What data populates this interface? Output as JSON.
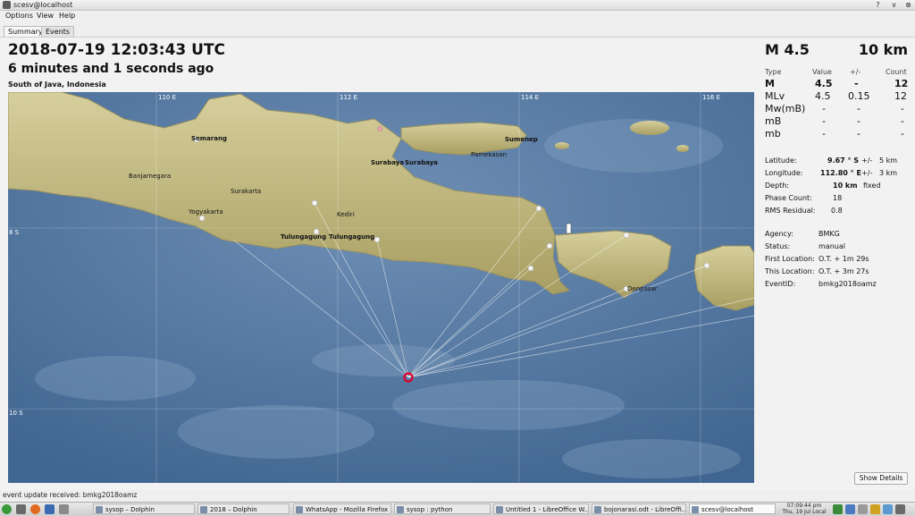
{
  "window": {
    "title": "scesv@localhost",
    "buttons": [
      "?",
      "∨",
      "⊗"
    ]
  },
  "menu": [
    "Options",
    "View",
    "Help"
  ],
  "tabs": [
    "Summary",
    "Events"
  ],
  "summary": {
    "datetime": "2018-07-19 12:03:43 UTC",
    "ago": "6 minutes and 1 seconds ago",
    "region": "South of Java, Indonesia",
    "magnitude_header": "M 4.5",
    "depth_header": "10 km"
  },
  "magnitude_table": {
    "headers": [
      "Type",
      "Value",
      "+/-",
      "Count"
    ],
    "rows": [
      {
        "type": "M",
        "value": "4.5",
        "pm": "-",
        "count": "12",
        "bold": true
      },
      {
        "type": "MLv",
        "value": "4.5",
        "pm": "0.15",
        "count": "12",
        "bold": false
      },
      {
        "type": "Mw(mB)",
        "value": "-",
        "pm": "-",
        "count": "-",
        "bold": false
      },
      {
        "type": "mB",
        "value": "-",
        "pm": "-",
        "count": "-",
        "bold": false
      },
      {
        "type": "mb",
        "value": "-",
        "pm": "-",
        "count": "-",
        "bold": false
      }
    ]
  },
  "location": {
    "latitude": {
      "label": "Latitude:",
      "value": "9.67 ° S",
      "pm": "+/-",
      "err": "5 km"
    },
    "longitude": {
      "label": "Longitude:",
      "value": "112.80 ° E",
      "pm": "+/-",
      "err": "3 km"
    },
    "depth": {
      "label": "Depth:",
      "value": "10 km",
      "note": "fixed"
    },
    "phase_count": {
      "label": "Phase Count:",
      "value": "18"
    },
    "rms": {
      "label": "RMS Residual:",
      "value": "0.8"
    }
  },
  "origin": {
    "agency": {
      "label": "Agency:",
      "value": "BMKG"
    },
    "status": {
      "label": "Status:",
      "value": "manual"
    },
    "first_location": {
      "label": "First Location:",
      "value": "O.T. + 1m 29s"
    },
    "this_location": {
      "label": "This Location:",
      "value": "O.T. + 3m 27s"
    },
    "event_id": {
      "label": "EventID:",
      "value": "bmkg2018oamz"
    }
  },
  "map": {
    "grid_labels": {
      "lon": [
        "110 E",
        "112 E",
        "114 E",
        "116 E"
      ],
      "lat": [
        "8 S",
        "10 S"
      ]
    },
    "cities": [
      "Semarang",
      "Banjarnegara",
      "Surakarta",
      "Yogyakarta",
      "Kediri",
      "Tulungagung",
      "Tulungagung",
      "Surabaya",
      "Surabaya",
      "Sumenep",
      "Pamekasan",
      "Denpasar"
    ],
    "colors": {
      "sea": "#4a6d96",
      "land": "#c8c08a",
      "epicenter": "#e0002a"
    }
  },
  "buttons": {
    "show_details": "Show Details"
  },
  "status_text": "event update received: bmkg2018oamz",
  "taskbar": {
    "items": [
      "sysop – Dolphin",
      "2018 – Dolphin",
      "WhatsApp - Mozilla Firefox",
      "sysop : python",
      "Untitled 1 - LibreOffice W...",
      "bojonarasi.odt - LibreOffi...",
      "scesv@localhost"
    ],
    "clock": {
      "time": "07:09:44 pm",
      "date": "Thu, 19 Jul Local"
    }
  }
}
